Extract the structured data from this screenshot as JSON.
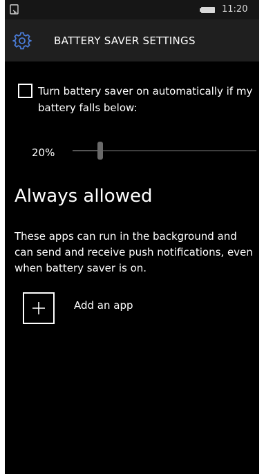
{
  "status_bar": {
    "time": "11:20",
    "left_icon": "notification-icon",
    "battery_icon": "battery-icon"
  },
  "header": {
    "icon": "gear-icon",
    "title": "BATTERY SAVER SETTINGS"
  },
  "auto_battery_saver": {
    "checked": false,
    "label": "Turn battery saver on automatically if my battery falls below:"
  },
  "threshold_slider": {
    "value_label": "20%",
    "value_fraction": 0.15
  },
  "always_allowed": {
    "heading": "Always allowed",
    "description": "These apps can run in the background and can send and receive push notifications, even when battery saver is on.",
    "add_app_label": "Add an app",
    "add_app_icon": "plus-icon"
  },
  "colors": {
    "background": "#000000",
    "title_bar": "#1f1f1f",
    "status_bar": "#161616",
    "accent": "#4a7cd8",
    "text": "#ffffff"
  }
}
